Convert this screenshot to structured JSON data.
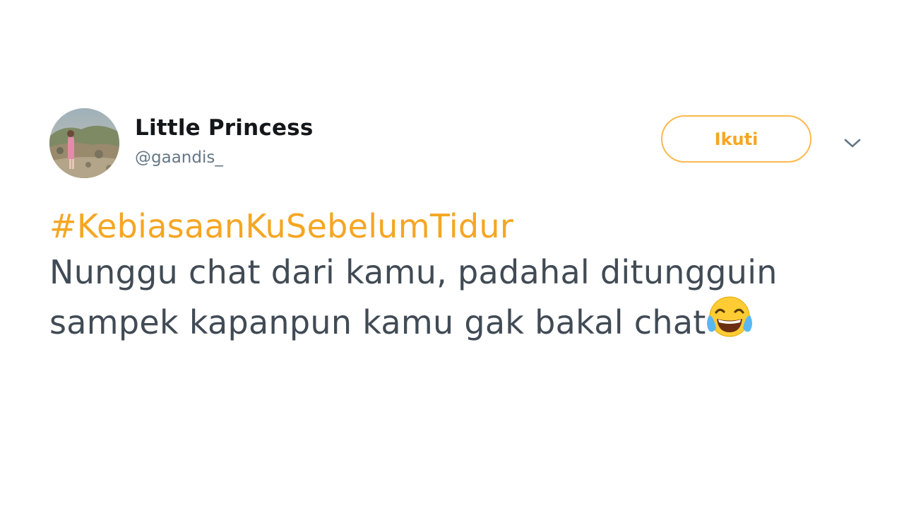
{
  "tweet": {
    "author": {
      "display_name": "Little Princess",
      "handle": "@gaandis_"
    },
    "follow_label": "Ikuti",
    "hashtag": "#KebiasaanKuSebelumTidur",
    "body_line1": "Nunggu chat dari kamu, padahal ditungguin",
    "body_line2": "sampek kapanpun kamu gak bakal chat",
    "emoji": "face-with-tears-of-joy"
  },
  "colors": {
    "accent": "#f5a623",
    "accent_border": "#ffb84d",
    "name_text": "#14171a",
    "handle_text": "#657786",
    "body_text": "#414b55",
    "caret": "#657786"
  },
  "icons": {
    "menu": "chevron-down-icon"
  }
}
